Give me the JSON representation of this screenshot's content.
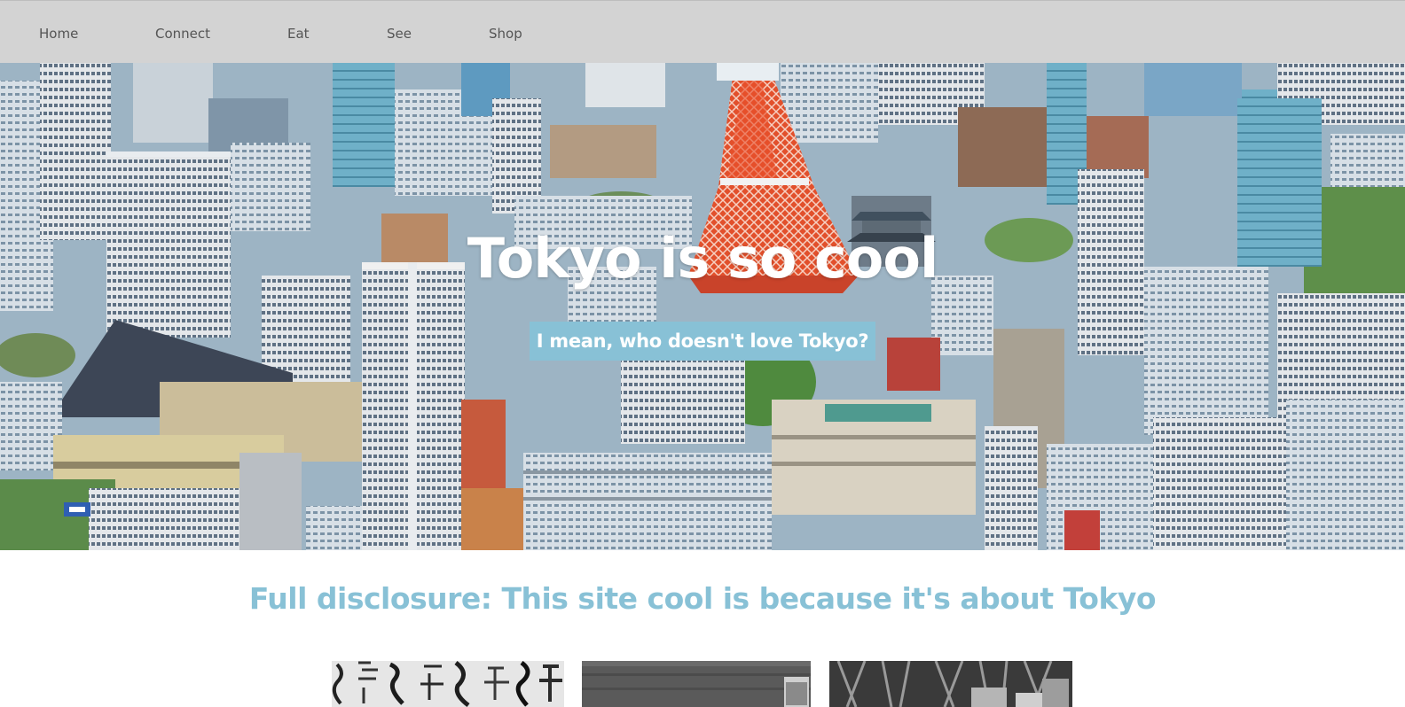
{
  "nav": {
    "items": [
      {
        "label": "Home"
      },
      {
        "label": "Connect"
      },
      {
        "label": "Eat"
      },
      {
        "label": "See"
      },
      {
        "label": "Shop"
      }
    ]
  },
  "hero": {
    "title": "Tokyo is so cool",
    "subtitle": "I mean, who doesn't love Tokyo?"
  },
  "main": {
    "heading": "Full disclosure: This site cool is because it's about Tokyo"
  },
  "colors": {
    "nav_bg": "#d3d3d3",
    "accent": "#88c1d6",
    "nav_text": "#555555"
  }
}
